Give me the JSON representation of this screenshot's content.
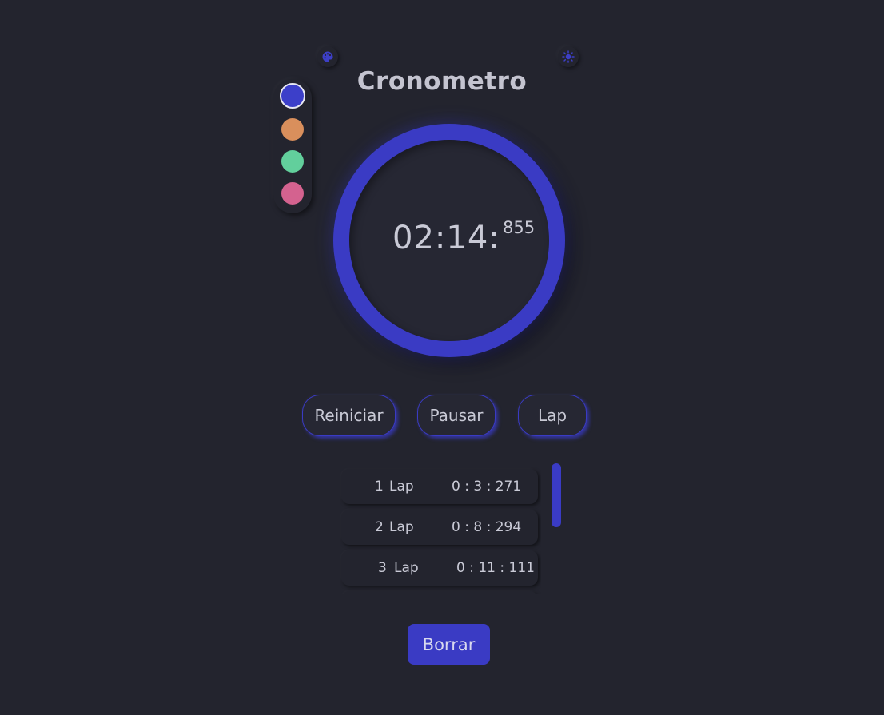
{
  "app": {
    "title": "Cronometro"
  },
  "toolbar": {
    "palette_icon": "palette-icon",
    "theme_icon": "sun-icon"
  },
  "colors": {
    "background": "#23242e",
    "accent": "#3a3bc4",
    "text": "#c9cad6"
  },
  "swatches": [
    {
      "name": "indigo",
      "color": "#3c3fc9",
      "selected": true
    },
    {
      "name": "orange",
      "color": "#d98f5c",
      "selected": false
    },
    {
      "name": "green",
      "color": "#62cf9c",
      "selected": false
    },
    {
      "name": "pink",
      "color": "#d4628f",
      "selected": false
    }
  ],
  "timer": {
    "main": "02:14:",
    "ms": "855"
  },
  "controls": {
    "reset_label": "Reiniciar",
    "pause_label": "Pausar",
    "lap_label": "Lap"
  },
  "laps": [
    {
      "num": "1",
      "word": "Lap",
      "time": "0 : 3 : 271"
    },
    {
      "num": "2",
      "word": "Lap",
      "time": "0 : 8 : 294"
    },
    {
      "num": "3",
      "word": "Lap",
      "time": "0 : 11 : 111"
    }
  ],
  "clear_label": "Borrar"
}
